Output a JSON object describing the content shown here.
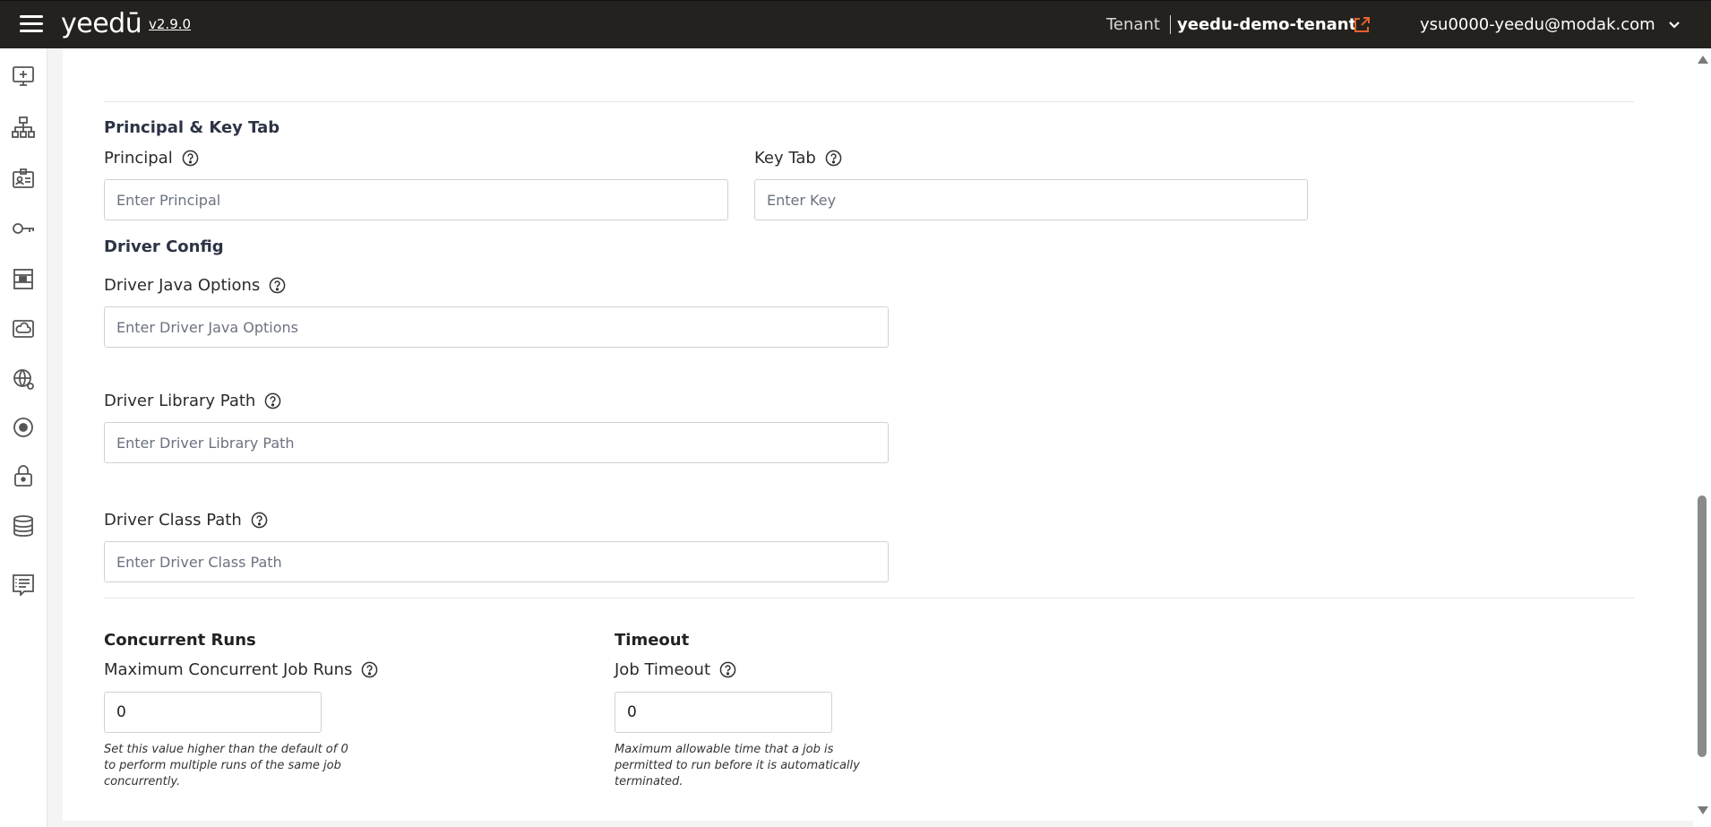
{
  "header": {
    "logo": "yeedū",
    "version": "v2.9.0",
    "tenant_label": "Tenant",
    "tenant_name": "yeedu-demo-tenant",
    "user_email": "ysu0000-yeedu@modak.com",
    "external_icon": "external-link-icon",
    "accent": "#e8622c"
  },
  "sidebar": {
    "items": [
      {
        "icon": "add-screen-icon"
      },
      {
        "icon": "hierarchy-icon"
      },
      {
        "icon": "id-card-icon"
      },
      {
        "icon": "key-icon"
      },
      {
        "icon": "building-icon"
      },
      {
        "icon": "cloud-drive-icon"
      },
      {
        "icon": "globe-network-icon"
      },
      {
        "icon": "disc-icon"
      },
      {
        "icon": "lock-icon"
      },
      {
        "icon": "database-icon"
      },
      {
        "icon": "notebook-icon"
      }
    ]
  },
  "principal_keytab": {
    "title": "Principal & Key Tab",
    "principal_label": "Principal",
    "principal_placeholder": "Enter Principal",
    "keytab_label": "Key Tab",
    "keytab_placeholder": "Enter Key"
  },
  "driver_config": {
    "title": "Driver Config",
    "java_options_label": "Driver Java Options",
    "java_options_placeholder": "Enter Driver Java Options",
    "library_path_label": "Driver Library Path",
    "library_path_placeholder": "Enter Driver Library Path",
    "class_path_label": "Driver Class Path",
    "class_path_placeholder": "Enter Driver Class Path"
  },
  "concurrent_runs": {
    "title": "Concurrent Runs",
    "label": "Maximum Concurrent Job Runs",
    "value": "0",
    "hint": "Set this value higher than the default of 0 to perform multiple runs of the same job concurrently."
  },
  "timeout": {
    "title": "Timeout",
    "label": "Job Timeout",
    "value": "0",
    "hint": "Maximum allowable time that a job is permitted to run before it is automatically terminated."
  }
}
